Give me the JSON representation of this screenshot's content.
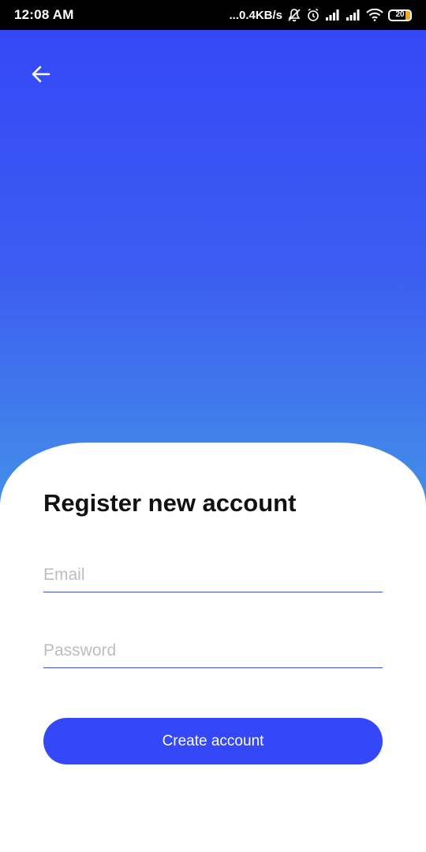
{
  "status_bar": {
    "time": "12:08 AM",
    "network_speed": "...0.4KB/s",
    "battery_level": "20",
    "icons": [
      "mute-icon",
      "alarm-icon",
      "signal-icon",
      "signal-icon",
      "wifi-icon",
      "battery-icon"
    ]
  },
  "colors": {
    "accent": "#3548f7",
    "gradient_top": "#3548f7",
    "gradient_bottom": "#4aa4e4",
    "battery": "#f5a623"
  },
  "header": {
    "back_icon": "arrow-left-icon"
  },
  "form": {
    "title": "Register new account",
    "email_placeholder": "Email",
    "email_value": "",
    "password_placeholder": "Password",
    "password_value": "",
    "submit_label": "Create account"
  }
}
